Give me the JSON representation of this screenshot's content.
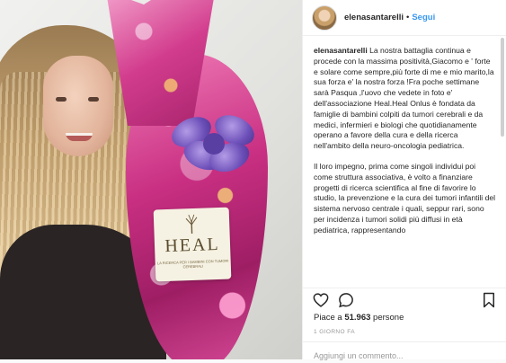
{
  "header": {
    "username": "elenasantarelli",
    "separator": "•",
    "follow_label": "Segui"
  },
  "caption": {
    "username": "elenasantarelli",
    "text": "La nostra battaglia continua e procede con la massima positività,Giacomo e ' forte e solare come sempre,più forte di me e mio marito,la sua forza e' la nostra forza !Fra poche settimane sarà Pasqua ,l'uovo che vedete in foto e' dell'associazione Heal.Heal Onlus è fondata da famiglie di bambini colpiti da tumori cerebrali e da medici, infermieri e biologi che quotidianamente operano a favore della cura e della ricerca nell'ambito della neuro-oncologia pediatrica.",
    "paragraph2": "Il loro impegno, prima come singoli individui poi come struttura associativa, è volto a finanziare progetti di ricerca scientifica al fine di favorire lo studio, la prevenzione e la cura dei tumori infantili del sistema nervoso centrale i quali, seppur rari, sono per incidenza i tumori solidi più diffusi in età pediatrica, rappresentando"
  },
  "photo": {
    "label_brand": "HEAL",
    "label_subtext": "LA RICERCA PER I BAMBINI CON TUMORI CEREBRALI"
  },
  "actions": {
    "like_icon": "heart-icon",
    "comment_icon": "comment-icon",
    "save_icon": "bookmark-icon"
  },
  "likes": {
    "prefix": "Piace a ",
    "count": "51.963",
    "suffix": " persone"
  },
  "timestamp": "1 GIORNO FA",
  "comment": {
    "placeholder": "Aggiungi un commento..."
  },
  "colors": {
    "link": "#3897f0",
    "text": "#262626",
    "muted": "#999999"
  }
}
